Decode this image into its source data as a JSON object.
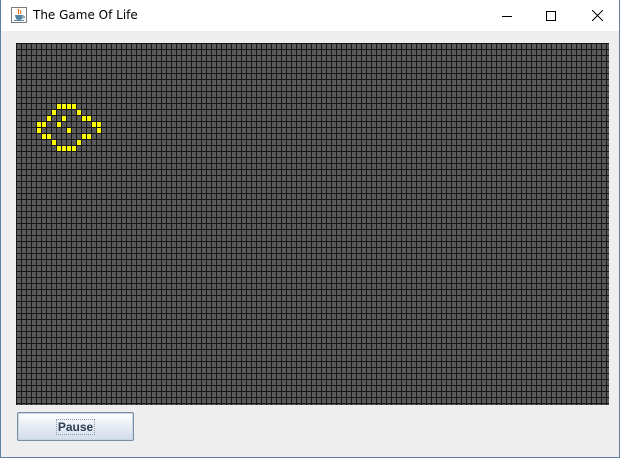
{
  "window": {
    "title": "The Game Of Life",
    "icon": "java-cup-icon",
    "controls": [
      "minimize-icon",
      "maximize-icon",
      "close-icon"
    ]
  },
  "board": {
    "columns": 118,
    "rows": 60,
    "background_color": "#5a5a5a",
    "grid_line_color": "#161616",
    "live_cell_color": "#ffff00",
    "live_cells": [
      [
        8,
        10
      ],
      [
        9,
        10
      ],
      [
        10,
        10
      ],
      [
        11,
        10
      ],
      [
        7,
        11
      ],
      [
        12,
        11
      ],
      [
        6,
        12
      ],
      [
        9,
        12
      ],
      [
        13,
        12
      ],
      [
        14,
        12
      ],
      [
        4,
        13
      ],
      [
        5,
        13
      ],
      [
        8,
        13
      ],
      [
        15,
        13
      ],
      [
        16,
        13
      ],
      [
        4,
        14
      ],
      [
        10,
        14
      ],
      [
        16,
        14
      ],
      [
        5,
        15
      ],
      [
        6,
        15
      ],
      [
        13,
        15
      ],
      [
        14,
        15
      ],
      [
        7,
        16
      ],
      [
        12,
        16
      ],
      [
        8,
        17
      ],
      [
        9,
        17
      ],
      [
        10,
        17
      ],
      [
        11,
        17
      ]
    ]
  },
  "controls": {
    "pause_label": "Pause"
  }
}
